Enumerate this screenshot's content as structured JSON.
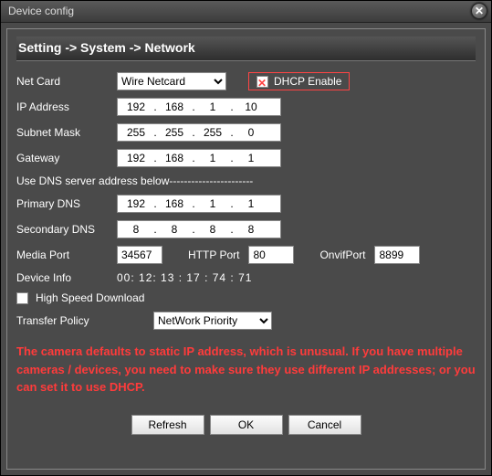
{
  "window": {
    "title": "Device config",
    "close_glyph": "✕"
  },
  "breadcrumb": "Setting -> System -> Network",
  "labels": {
    "net_card": "Net Card",
    "dhcp_enable": "DHCP Enable",
    "ip_address": "IP Address",
    "subnet_mask": "Subnet Mask",
    "gateway": "Gateway",
    "dns_note": "Use DNS server address below-----------------------",
    "primary_dns": "Primary DNS",
    "secondary_dns": "Secondary DNS",
    "media_port": "Media Port",
    "http_port": "HTTP Port",
    "onvif_port": "OnvifPort",
    "device_info": "Device Info",
    "high_speed": "High Speed Download",
    "transfer_policy": "Transfer Policy"
  },
  "net_card": {
    "selected": "Wire Netcard",
    "options": [
      "Wire Netcard"
    ]
  },
  "dhcp_enabled": false,
  "ip": [
    "192",
    "168",
    "1",
    "10"
  ],
  "subnet": [
    "255",
    "255",
    "255",
    "0"
  ],
  "gateway": [
    "192",
    "168",
    "1",
    "1"
  ],
  "primary_dns": [
    "192",
    "168",
    "1",
    "1"
  ],
  "secondary_dns": [
    "8",
    "8",
    "8",
    "8"
  ],
  "ports": {
    "media": "34567",
    "http": "80",
    "onvif": "8899"
  },
  "mac": "00: 12: 13 : 17 : 74 : 71",
  "high_speed_download": false,
  "transfer_policy": {
    "selected": "NetWork Priority",
    "options": [
      "NetWork Priority"
    ]
  },
  "warning_text": "The camera defaults to static IP address, which is unusual. If you have multiple cameras / devices, you need to make sure they use different IP addresses; or you can set it to use DHCP.",
  "buttons": {
    "refresh": "Refresh",
    "ok": "OK",
    "cancel": "Cancel"
  }
}
